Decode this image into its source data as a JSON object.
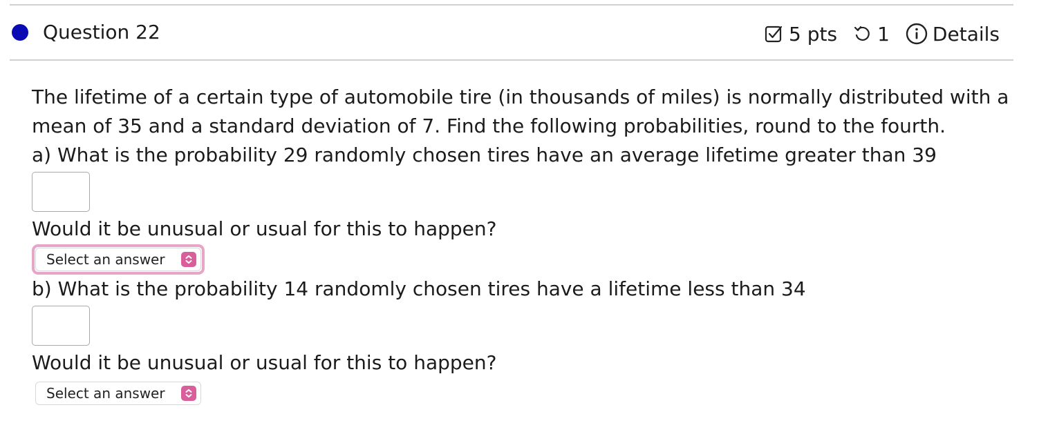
{
  "header": {
    "question_title": "Question 22",
    "points": "5 pts",
    "attempts": "1",
    "details": "Details",
    "status_color": "#0b0bb3",
    "icons": [
      "edit-checkbox-icon",
      "retry-icon",
      "info-icon"
    ]
  },
  "question": {
    "text": [
      "The lifetime of a certain type of automobile tire (in thousands of miles) is normally distributed with a",
      "mean of 35 and a standard deviation of 7. Find the following probabilities, round to the fourth.",
      "a) What is the probability 29 randomly chosen tires have an average lifetime greater than 39"
    ],
    "part_a": {
      "answer_value": "",
      "followup": "Would it be unusual or usual for this to happen?",
      "select_value": "Select an answer"
    },
    "part_b": {
      "prompt": "b) What is the probability 14 randomly chosen tires have a lifetime less than 34",
      "answer_value": "",
      "followup": "Would it be unusual or usual for this to happen?",
      "select_value": "Select an answer"
    }
  },
  "colors": {
    "select_arrow_bg": "#d85f9a",
    "focus_ring": "#e7a6c8"
  }
}
